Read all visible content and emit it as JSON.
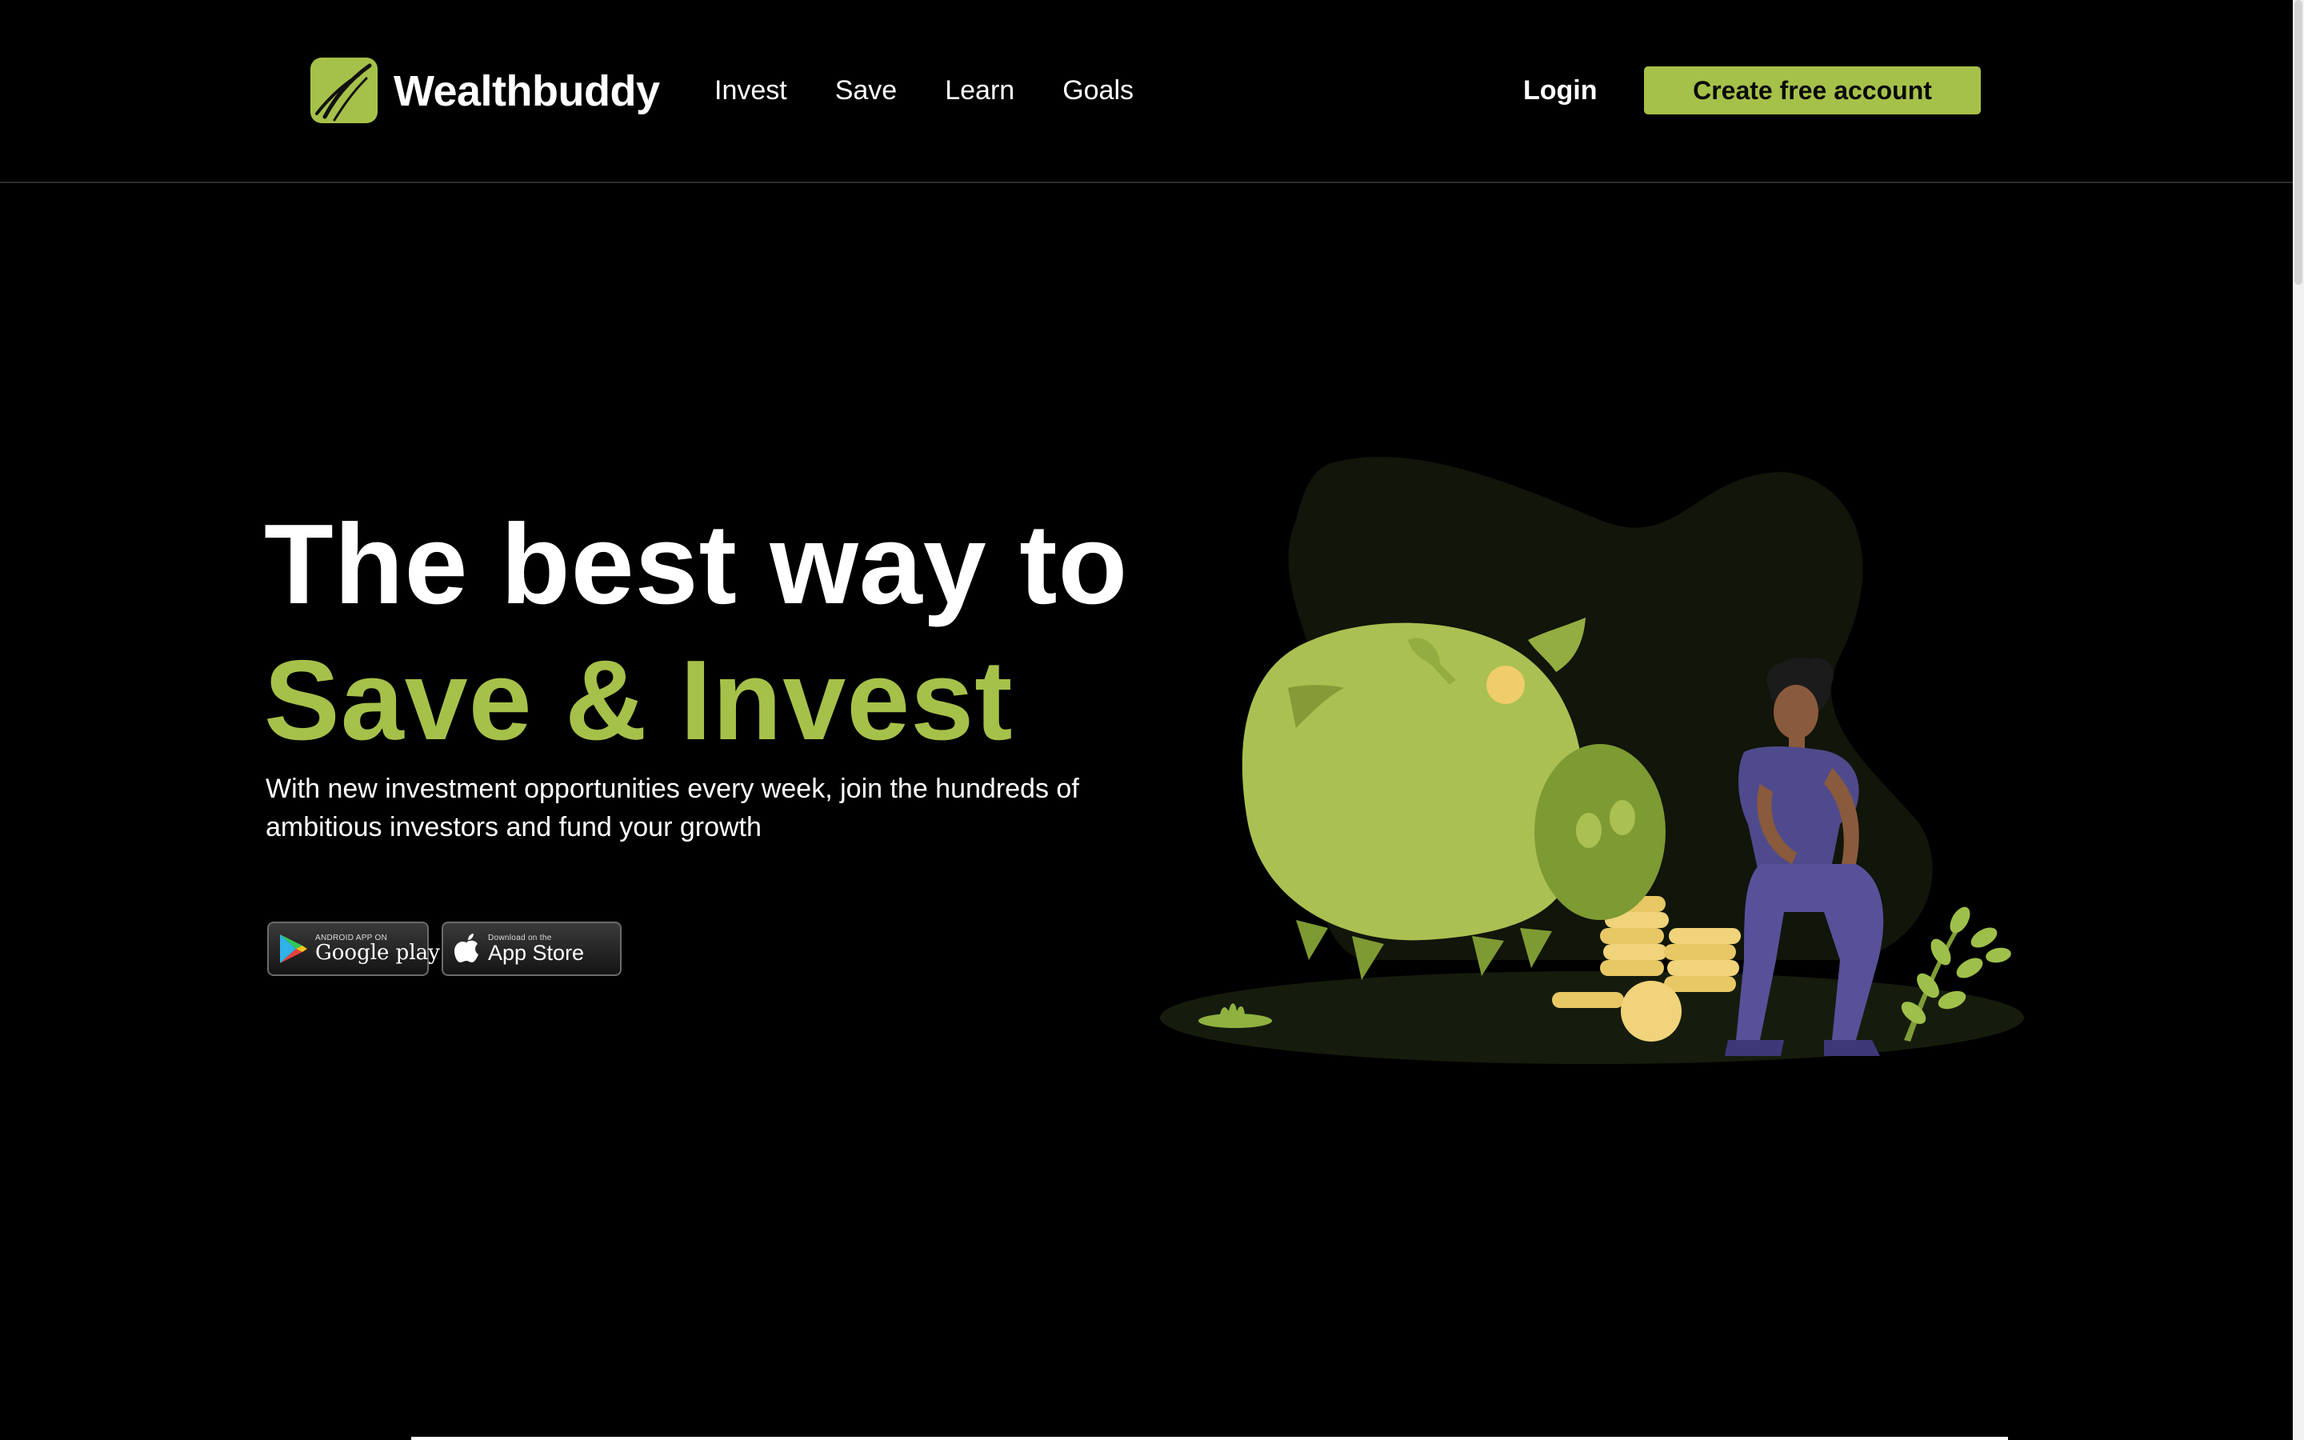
{
  "brand": {
    "name": "Wealthbuddy",
    "accent": "#a6c14a"
  },
  "nav": {
    "items": [
      {
        "label": "Invest"
      },
      {
        "label": "Save"
      },
      {
        "label": "Learn"
      },
      {
        "label": "Goals"
      }
    ],
    "login_label": "Login",
    "cta_label": "Create free account"
  },
  "hero": {
    "title_line1": "The best way to",
    "title_line2": "Save & Invest",
    "subtitle": "With new investment opportunities every week, join the hundreds of ambitious investors and fund your growth"
  },
  "store_badges": {
    "google": {
      "small": "ANDROID APP ON",
      "big": "Google play",
      "icon": "google-play-icon"
    },
    "apple": {
      "small": "Download on the",
      "big": "App Store",
      "icon": "apple-icon"
    }
  },
  "illustration": {
    "subject": "piggy-bank-illustration"
  }
}
